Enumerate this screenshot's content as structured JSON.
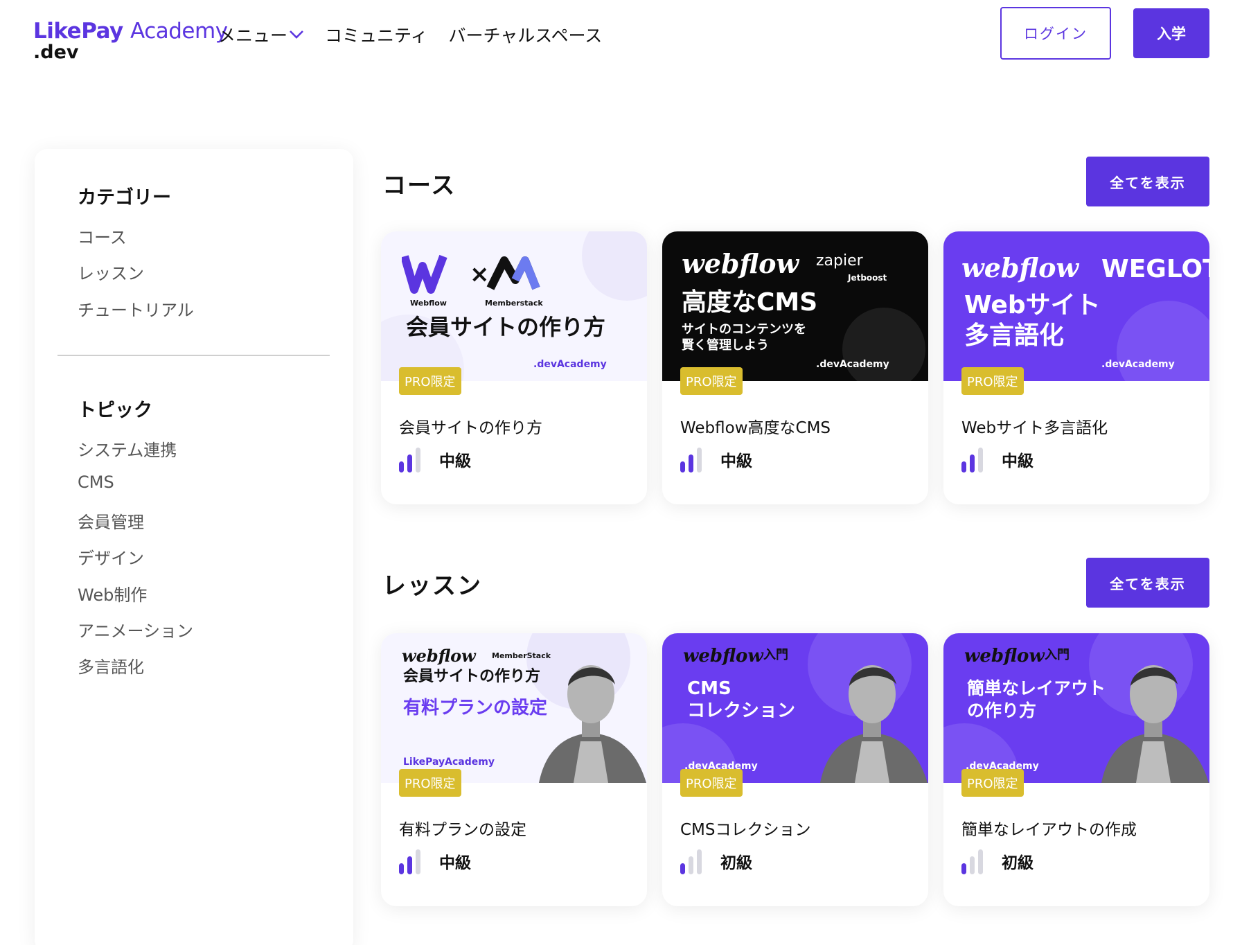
{
  "header": {
    "logo_main": "LikePay",
    "logo_academy": "Academy",
    "logo_sub": ".dev",
    "nav": [
      "メニュー",
      "コミュニティ",
      "バーチャルスペース"
    ],
    "login": "ログイン",
    "join": "入学"
  },
  "sidebar": {
    "category_heading": "カテゴリー",
    "categories": [
      "コース",
      "レッスン",
      "チュートリアル"
    ],
    "topic_heading": "トピック",
    "topics": [
      "システム連携",
      "CMS",
      "会員管理",
      "デザイン",
      "Web制作",
      "アニメーション",
      "多言語化"
    ]
  },
  "courses": {
    "title": "コース",
    "view_all": "全てを表示",
    "cards": [
      {
        "title": "会員サイトの作り方",
        "badge": "PRO限定",
        "level": "中級",
        "level_value": 2,
        "thumb": {
          "line1": "会員サイトの作り方",
          "logo_left": "Webflow",
          "logo_right": "Memberstack",
          "footer": ".devAcademy"
        }
      },
      {
        "title": "Webflow高度なCMS",
        "badge": "PRO限定",
        "level": "中級",
        "level_value": 2,
        "thumb": {
          "brand": "webflow",
          "partner1": "zapier",
          "partner2": "Jetboost",
          "line1": "高度なCMS",
          "line2": "サイトのコンテンツを",
          "line3": "賢く管理しよう",
          "footer": ".devAcademy"
        }
      },
      {
        "title": "Webサイト多言語化",
        "badge": "PRO限定",
        "level": "中級",
        "level_value": 2,
        "thumb": {
          "brand": "webflow",
          "partner": "WEGLOT",
          "line1": "Webサイト",
          "line2": "多言語化",
          "footer": ".devAcademy"
        }
      }
    ]
  },
  "lessons": {
    "title": "レッスン",
    "view_all": "全てを表示",
    "cards": [
      {
        "title": "有料プランの設定",
        "badge": "PRO限定",
        "level": "中級",
        "level_value": 2,
        "thumb": {
          "brand": "webflow",
          "partner": "MemberStack",
          "line1": "会員サイトの作り方",
          "line2": "有料プランの設定",
          "footer": "LikePayAcademy"
        }
      },
      {
        "title": "CMSコレクション",
        "badge": "PRO限定",
        "level": "初級",
        "level_value": 1,
        "thumb": {
          "brand": "webflow",
          "tag": "入門",
          "line1": "CMS",
          "line2": "コレクション",
          "footer": ".devAcademy"
        }
      },
      {
        "title": "簡単なレイアウトの作成",
        "badge": "PRO限定",
        "level": "初級",
        "level_value": 1,
        "thumb": {
          "brand": "webflow",
          "tag": "入門",
          "line1": "簡単なレイアウト",
          "line2": "の作り方",
          "footer": ".devAcademy"
        }
      }
    ]
  },
  "colors": {
    "accent": "#5b35e0",
    "badge": "#d9bd2e",
    "bar_off": "#d8d8e0"
  }
}
